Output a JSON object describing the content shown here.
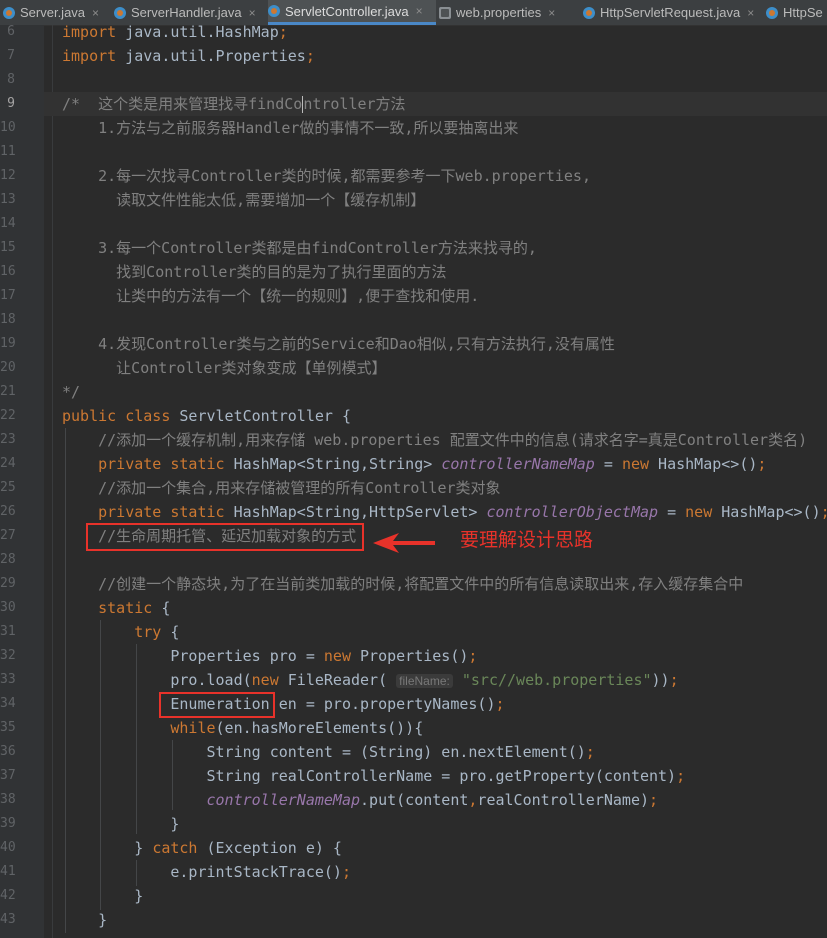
{
  "tabs": [
    {
      "label": "Server.java",
      "icon": "java-class-icon",
      "closable": true
    },
    {
      "label": "ServerHandler.java",
      "icon": "java-class-icon",
      "closable": true
    },
    {
      "label": "ServletController.java",
      "icon": "java-class-icon",
      "closable": true,
      "active": true
    },
    {
      "label": "web.properties",
      "icon": "properties-file-icon",
      "closable": true
    },
    {
      "label": "HttpServletRequest.java",
      "icon": "java-class-icon",
      "closable": true
    },
    {
      "label": "HttpSe",
      "icon": "java-class-icon",
      "closable": false
    }
  ],
  "close_glyph": "×",
  "editor": {
    "current_line": "9",
    "lines": [
      {
        "n": "6",
        "tokens": [
          {
            "t": "kw",
            "v": "import"
          },
          {
            "t": "",
            "v": " java.util.HashMap"
          },
          {
            "t": "kw",
            "v": ";"
          }
        ]
      },
      {
        "n": "7",
        "tokens": [
          {
            "t": "kw",
            "v": "import"
          },
          {
            "t": "",
            "v": " java.util.Properties"
          },
          {
            "t": "kw",
            "v": ";"
          }
        ]
      },
      {
        "n": "8",
        "tokens": []
      },
      {
        "n": "9",
        "tokens": [
          {
            "t": "cm",
            "v": "/*  这个类是用来管理找寻findCo"
          },
          {
            "t": "caret",
            "v": ""
          },
          {
            "t": "cm",
            "v": "ntroller方法"
          }
        ]
      },
      {
        "n": "10",
        "tokens": [
          {
            "t": "cm",
            "v": "    1.方法与之前服务器Handler做的事情不一致,所以要抽离出来"
          }
        ]
      },
      {
        "n": "11",
        "tokens": []
      },
      {
        "n": "12",
        "tokens": [
          {
            "t": "cm",
            "v": "    2.每一次找寻Controller类的时候,都需要参考一下web.properties,"
          }
        ]
      },
      {
        "n": "13",
        "tokens": [
          {
            "t": "cm",
            "v": "      读取文件性能太低,需要增加一个【缓存机制】"
          }
        ]
      },
      {
        "n": "14",
        "tokens": []
      },
      {
        "n": "15",
        "tokens": [
          {
            "t": "cm",
            "v": "    3.每一个Controller类都是由findController方法来找寻的,"
          }
        ]
      },
      {
        "n": "16",
        "tokens": [
          {
            "t": "cm",
            "v": "      找到Controller类的目的是为了执行里面的方法"
          }
        ]
      },
      {
        "n": "17",
        "tokens": [
          {
            "t": "cm",
            "v": "      让类中的方法有一个【统一的规则】,便于查找和使用."
          }
        ]
      },
      {
        "n": "18",
        "tokens": []
      },
      {
        "n": "19",
        "tokens": [
          {
            "t": "cm",
            "v": "    4.发现Controller类与之前的Service和Dao相似,只有方法执行,没有属性"
          }
        ]
      },
      {
        "n": "20",
        "tokens": [
          {
            "t": "cm",
            "v": "      让Controller类对象变成【单例模式】"
          }
        ]
      },
      {
        "n": "21",
        "tokens": [
          {
            "t": "cm",
            "v": "*/"
          }
        ]
      },
      {
        "n": "22",
        "tokens": [
          {
            "t": "kw",
            "v": "public class"
          },
          {
            "t": "",
            "v": " ServletController {"
          }
        ]
      },
      {
        "n": "23",
        "tokens": [
          {
            "t": "cm",
            "v": "    //添加一个缓存机制,用来存储 web.properties 配置文件中的信息(请求名字=真是Controller类名)"
          }
        ]
      },
      {
        "n": "24",
        "tokens": [
          {
            "t": "kw",
            "v": "    private static"
          },
          {
            "t": "",
            "v": " HashMap<String,String> "
          },
          {
            "t": "fld",
            "v": "controllerNameMap"
          },
          {
            "t": "",
            "v": " = "
          },
          {
            "t": "kw",
            "v": "new"
          },
          {
            "t": "",
            "v": " HashMap<>()"
          },
          {
            "t": "kw",
            "v": ";"
          }
        ]
      },
      {
        "n": "25",
        "tokens": [
          {
            "t": "cm",
            "v": "    //添加一个集合,用来存储被管理的所有Controller类对象"
          }
        ]
      },
      {
        "n": "26",
        "tokens": [
          {
            "t": "kw",
            "v": "    private static"
          },
          {
            "t": "",
            "v": " HashMap<String,HttpServlet> "
          },
          {
            "t": "fld",
            "v": "controllerObjectMap"
          },
          {
            "t": "",
            "v": " = "
          },
          {
            "t": "kw",
            "v": "new"
          },
          {
            "t": "",
            "v": " HashMap<>()"
          },
          {
            "t": "kw",
            "v": ";"
          }
        ]
      },
      {
        "n": "27",
        "tokens": [
          {
            "t": "cm",
            "v": "    //生命周期托管、延迟加载对象的方式"
          }
        ]
      },
      {
        "n": "28",
        "tokens": []
      },
      {
        "n": "29",
        "tokens": [
          {
            "t": "cm",
            "v": "    //创建一个静态块,为了在当前类加载的时候,将配置文件中的所有信息读取出来,存入缓存集合中"
          }
        ]
      },
      {
        "n": "30",
        "tokens": [
          {
            "t": "kw",
            "v": "    static"
          },
          {
            "t": "",
            "v": " {"
          }
        ]
      },
      {
        "n": "31",
        "tokens": [
          {
            "t": "kw",
            "v": "        try"
          },
          {
            "t": "",
            "v": " {"
          }
        ]
      },
      {
        "n": "32",
        "tokens": [
          {
            "t": "",
            "v": "            Properties pro = "
          },
          {
            "t": "kw",
            "v": "new"
          },
          {
            "t": "",
            "v": " Properties()"
          },
          {
            "t": "kw",
            "v": ";"
          }
        ]
      },
      {
        "n": "33",
        "tokens": [
          {
            "t": "",
            "v": "            pro.load("
          },
          {
            "t": "kw",
            "v": "new"
          },
          {
            "t": "",
            "v": " FileReader( "
          },
          {
            "t": "hint",
            "v": "fileName:"
          },
          {
            "t": "",
            "v": " "
          },
          {
            "t": "str",
            "v": "\"src//web.properties\""
          },
          {
            "t": "",
            "v": "))"
          },
          {
            "t": "kw",
            "v": ";"
          }
        ]
      },
      {
        "n": "34",
        "tokens": [
          {
            "t": "",
            "v": "            Enumeration en = pro.propertyNames()"
          },
          {
            "t": "kw",
            "v": ";"
          }
        ]
      },
      {
        "n": "35",
        "tokens": [
          {
            "t": "kw",
            "v": "            while"
          },
          {
            "t": "",
            "v": "(en.hasMoreElements()){"
          }
        ]
      },
      {
        "n": "36",
        "tokens": [
          {
            "t": "",
            "v": "                String content = (String) en.nextElement()"
          },
          {
            "t": "kw",
            "v": ";"
          }
        ]
      },
      {
        "n": "37",
        "tokens": [
          {
            "t": "",
            "v": "                String realControllerName = pro.getProperty(content)"
          },
          {
            "t": "kw",
            "v": ";"
          }
        ]
      },
      {
        "n": "38",
        "tokens": [
          {
            "t": "fld",
            "v": "                controllerNameMap"
          },
          {
            "t": "",
            "v": ".put(content"
          },
          {
            "t": "kw",
            "v": ","
          },
          {
            "t": "",
            "v": "realControllerName)"
          },
          {
            "t": "kw",
            "v": ";"
          }
        ]
      },
      {
        "n": "39",
        "tokens": [
          {
            "t": "",
            "v": "            }"
          }
        ]
      },
      {
        "n": "40",
        "tokens": [
          {
            "t": "",
            "v": "        } "
          },
          {
            "t": "kw",
            "v": "catch"
          },
          {
            "t": "",
            "v": " (Exception e) {"
          }
        ]
      },
      {
        "n": "41",
        "tokens": [
          {
            "t": "",
            "v": "            e.printStackTrace()"
          },
          {
            "t": "kw",
            "v": ";"
          }
        ]
      },
      {
        "n": "42",
        "tokens": [
          {
            "t": "",
            "v": "        }"
          }
        ]
      },
      {
        "n": "43",
        "tokens": [
          {
            "t": "",
            "v": "    }"
          }
        ]
      }
    ]
  },
  "annotation": {
    "text": "要理解设计思路",
    "color": "#e8322a"
  },
  "colors": {
    "background": "#2b2b2b",
    "keyword": "#cc7832",
    "comment": "#808080",
    "field": "#9876aa",
    "string": "#6a8759",
    "text": "#a9b7c6"
  }
}
